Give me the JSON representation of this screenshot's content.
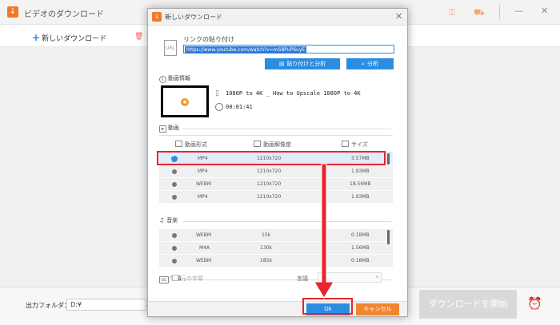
{
  "app": {
    "title": "ビデオのダウンロード",
    "new_download": "新しいダウンロード",
    "output_folder_label": "出力フォルダ：",
    "output_folder_value": "D:¥",
    "start_button": "ダウンロードを開始"
  },
  "dialog": {
    "title": "新しいダウンロード",
    "url_label": "リンクの貼り付け",
    "url_value": "https://www.youtube.com/watch?v=mS8PuP6uyE",
    "paste_analyze_button": "貼り付けと分析",
    "analyze_button": "分析",
    "video_info_label": "動画情報",
    "video_title": "1080P to 4K _ How to Upscale 1080P to 4K",
    "video_duration": "00:01:41",
    "video_section": "動画",
    "col_format": "動画形式",
    "col_resolution": "動画解像度",
    "col_size": "サイズ",
    "video_rows": [
      {
        "format": "MP4",
        "resolution": "1210x720",
        "size": "3.57MB"
      },
      {
        "format": "MP4",
        "resolution": "1210x720",
        "size": "1.93MB"
      },
      {
        "format": "WEBM",
        "resolution": "1210x720",
        "size": "18.56MB"
      },
      {
        "format": "MP4",
        "resolution": "1210x720",
        "size": "1.93MB"
      }
    ],
    "audio_section": "音楽",
    "audio_rows": [
      {
        "format": "WEBM",
        "bitrate": "15k",
        "size": "0.18MB"
      },
      {
        "format": "M4A",
        "bitrate": "130k",
        "size": "1.56MB"
      },
      {
        "format": "WEBM",
        "bitrate": "185k",
        "size": "0.18MB"
      }
    ],
    "subtitle_section": "字幕",
    "original_subtitle": "元の字幕",
    "language_label": "言語",
    "ok_button": "Ok",
    "cancel_button": "キャンセル"
  },
  "colors": {
    "accent_blue": "#2c8de0",
    "accent_orange": "#f0862e",
    "highlight_red": "#e8242c"
  }
}
